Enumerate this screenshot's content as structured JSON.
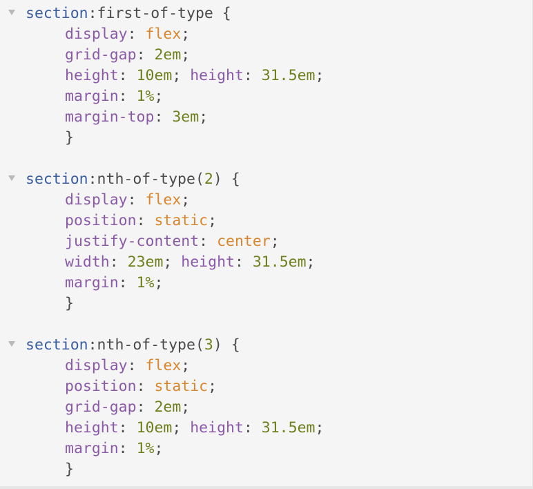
{
  "rules": [
    {
      "selector": "section",
      "pseudo": ":first-of-type",
      "paren_open": "",
      "arg": "",
      "paren_close": "",
      "open_brace": " {",
      "declarations": [
        {
          "parts": [
            {
              "t": "p",
              "v": "display"
            },
            {
              "t": "c",
              "v": ": "
            },
            {
              "t": "k",
              "v": "flex"
            },
            {
              "t": "c",
              "v": ";"
            }
          ]
        },
        {
          "parts": [
            {
              "t": "p",
              "v": "grid-gap"
            },
            {
              "t": "c",
              "v": ": "
            },
            {
              "t": "v",
              "v": "2em"
            },
            {
              "t": "c",
              "v": ";"
            }
          ]
        },
        {
          "parts": [
            {
              "t": "p",
              "v": "height"
            },
            {
              "t": "c",
              "v": ": "
            },
            {
              "t": "v",
              "v": "10em"
            },
            {
              "t": "c",
              "v": "; "
            },
            {
              "t": "p",
              "v": "height"
            },
            {
              "t": "c",
              "v": ": "
            },
            {
              "t": "v",
              "v": "31.5em"
            },
            {
              "t": "c",
              "v": ";"
            }
          ]
        },
        {
          "parts": [
            {
              "t": "p",
              "v": "margin"
            },
            {
              "t": "c",
              "v": ": "
            },
            {
              "t": "v",
              "v": "1%"
            },
            {
              "t": "c",
              "v": ";"
            }
          ]
        },
        {
          "parts": [
            {
              "t": "p",
              "v": "margin-top"
            },
            {
              "t": "c",
              "v": ": "
            },
            {
              "t": "v",
              "v": "3em"
            },
            {
              "t": "c",
              "v": ";"
            }
          ]
        }
      ],
      "close_brace": "}"
    },
    {
      "selector": "section",
      "pseudo": ":nth-of-type",
      "paren_open": "(",
      "arg": "2",
      "paren_close": ")",
      "open_brace": " {",
      "declarations": [
        {
          "parts": [
            {
              "t": "p",
              "v": "display"
            },
            {
              "t": "c",
              "v": ": "
            },
            {
              "t": "k",
              "v": "flex"
            },
            {
              "t": "c",
              "v": ";"
            }
          ]
        },
        {
          "parts": [
            {
              "t": "p",
              "v": "position"
            },
            {
              "t": "c",
              "v": ": "
            },
            {
              "t": "k",
              "v": "static"
            },
            {
              "t": "c",
              "v": ";"
            }
          ]
        },
        {
          "parts": [
            {
              "t": "p",
              "v": "justify-content"
            },
            {
              "t": "c",
              "v": ": "
            },
            {
              "t": "k",
              "v": "center"
            },
            {
              "t": "c",
              "v": ";"
            }
          ]
        },
        {
          "parts": [
            {
              "t": "p",
              "v": "width"
            },
            {
              "t": "c",
              "v": ": "
            },
            {
              "t": "v",
              "v": "23em"
            },
            {
              "t": "c",
              "v": "; "
            },
            {
              "t": "p",
              "v": "height"
            },
            {
              "t": "c",
              "v": ": "
            },
            {
              "t": "v",
              "v": "31.5em"
            },
            {
              "t": "c",
              "v": ";"
            }
          ]
        },
        {
          "parts": [
            {
              "t": "p",
              "v": "margin"
            },
            {
              "t": "c",
              "v": ": "
            },
            {
              "t": "v",
              "v": "1%"
            },
            {
              "t": "c",
              "v": ";"
            }
          ]
        }
      ],
      "close_brace": "}"
    },
    {
      "selector": "section",
      "pseudo": ":nth-of-type",
      "paren_open": "(",
      "arg": "3",
      "paren_close": ")",
      "open_brace": " {",
      "declarations": [
        {
          "parts": [
            {
              "t": "p",
              "v": "display"
            },
            {
              "t": "c",
              "v": ": "
            },
            {
              "t": "k",
              "v": "flex"
            },
            {
              "t": "c",
              "v": ";"
            }
          ]
        },
        {
          "parts": [
            {
              "t": "p",
              "v": "position"
            },
            {
              "t": "c",
              "v": ": "
            },
            {
              "t": "k",
              "v": "static"
            },
            {
              "t": "c",
              "v": ";"
            }
          ]
        },
        {
          "parts": [
            {
              "t": "p",
              "v": "grid-gap"
            },
            {
              "t": "c",
              "v": ": "
            },
            {
              "t": "v",
              "v": "2em"
            },
            {
              "t": "c",
              "v": ";"
            }
          ]
        },
        {
          "parts": [
            {
              "t": "p",
              "v": "height"
            },
            {
              "t": "c",
              "v": ": "
            },
            {
              "t": "v",
              "v": "10em"
            },
            {
              "t": "c",
              "v": "; "
            },
            {
              "t": "p",
              "v": "height"
            },
            {
              "t": "c",
              "v": ": "
            },
            {
              "t": "v",
              "v": "31.5em"
            },
            {
              "t": "c",
              "v": ";"
            }
          ]
        },
        {
          "parts": [
            {
              "t": "p",
              "v": "margin"
            },
            {
              "t": "c",
              "v": ": "
            },
            {
              "t": "v",
              "v": "1%"
            },
            {
              "t": "c",
              "v": ";"
            }
          ]
        }
      ],
      "close_brace": "}"
    }
  ],
  "icons": {
    "fold": "fold-arrow-icon"
  },
  "colors": {
    "background": "#f5f5f5",
    "selector": "#3a5f9e",
    "property": "#8a5aa8",
    "keyword": "#d9852b",
    "value": "#6f7f1c",
    "punctuation": "#4a4a4a",
    "fold_arrow": "#b8b8b8"
  }
}
